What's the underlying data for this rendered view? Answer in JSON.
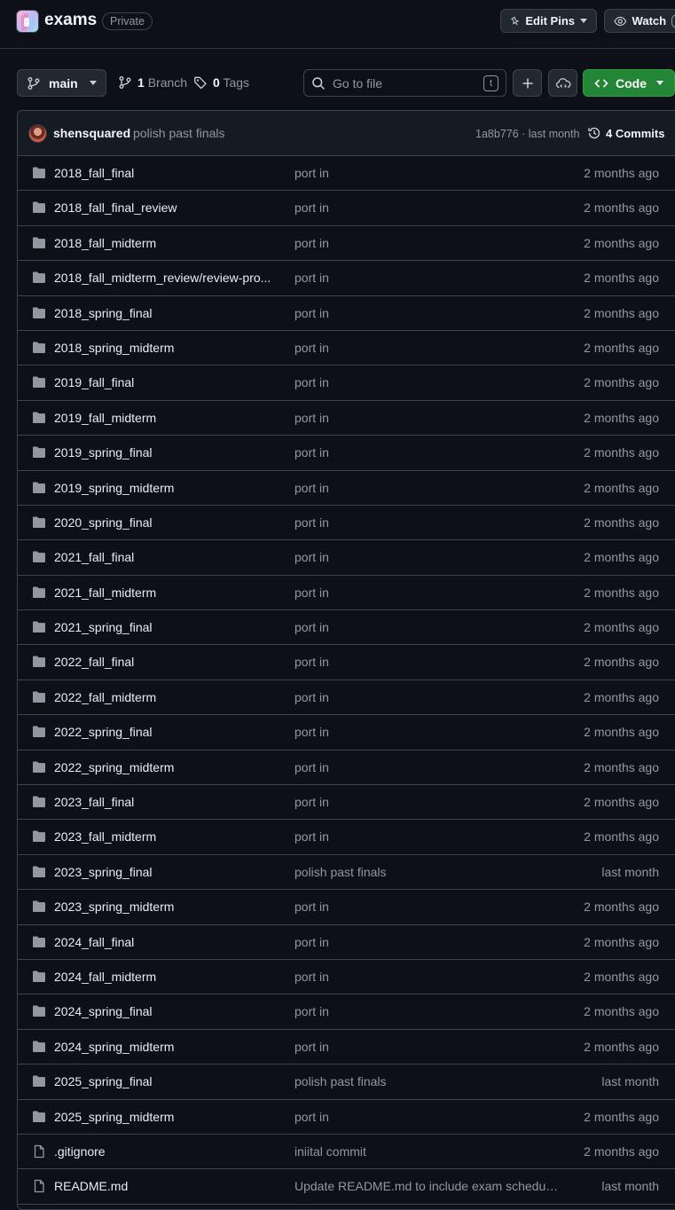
{
  "repo": {
    "name": "exams",
    "visibility": "Private"
  },
  "header_actions": {
    "edit_pins_label": "Edit Pins",
    "watch_label": "Watch"
  },
  "toolbar": {
    "branch_name": "main",
    "branch_count": "1",
    "branch_label": "Branch",
    "tag_count": "0",
    "tag_label": "Tags",
    "search_placeholder": "Go to file",
    "search_shortcut": "t",
    "code_label": "Code"
  },
  "latest_commit": {
    "author": "shensquared",
    "message": "polish past finals",
    "hash_and_time": "1a8b776 · last month",
    "commits_label": "4 Commits"
  },
  "files": [
    {
      "type": "folder",
      "name": "2018_fall_final",
      "message": "port in",
      "date": "2 months ago"
    },
    {
      "type": "folder",
      "name": "2018_fall_final_review",
      "message": "port in",
      "date": "2 months ago"
    },
    {
      "type": "folder",
      "name": "2018_fall_midterm",
      "message": "port in",
      "date": "2 months ago"
    },
    {
      "type": "folder",
      "name": "2018_fall_midterm_review/review-pro...",
      "message": "port in",
      "date": "2 months ago"
    },
    {
      "type": "folder",
      "name": "2018_spring_final",
      "message": "port in",
      "date": "2 months ago"
    },
    {
      "type": "folder",
      "name": "2018_spring_midterm",
      "message": "port in",
      "date": "2 months ago"
    },
    {
      "type": "folder",
      "name": "2019_fall_final",
      "message": "port in",
      "date": "2 months ago"
    },
    {
      "type": "folder",
      "name": "2019_fall_midterm",
      "message": "port in",
      "date": "2 months ago"
    },
    {
      "type": "folder",
      "name": "2019_spring_final",
      "message": "port in",
      "date": "2 months ago"
    },
    {
      "type": "folder",
      "name": "2019_spring_midterm",
      "message": "port in",
      "date": "2 months ago"
    },
    {
      "type": "folder",
      "name": "2020_spring_final",
      "message": "port in",
      "date": "2 months ago"
    },
    {
      "type": "folder",
      "name": "2021_fall_final",
      "message": "port in",
      "date": "2 months ago"
    },
    {
      "type": "folder",
      "name": "2021_fall_midterm",
      "message": "port in",
      "date": "2 months ago"
    },
    {
      "type": "folder",
      "name": "2021_spring_final",
      "message": "port in",
      "date": "2 months ago"
    },
    {
      "type": "folder",
      "name": "2022_fall_final",
      "message": "port in",
      "date": "2 months ago"
    },
    {
      "type": "folder",
      "name": "2022_fall_midterm",
      "message": "port in",
      "date": "2 months ago"
    },
    {
      "type": "folder",
      "name": "2022_spring_final",
      "message": "port in",
      "date": "2 months ago"
    },
    {
      "type": "folder",
      "name": "2022_spring_midterm",
      "message": "port in",
      "date": "2 months ago"
    },
    {
      "type": "folder",
      "name": "2023_fall_final",
      "message": "port in",
      "date": "2 months ago"
    },
    {
      "type": "folder",
      "name": "2023_fall_midterm",
      "message": "port in",
      "date": "2 months ago"
    },
    {
      "type": "folder",
      "name": "2023_spring_final",
      "message": "polish past finals",
      "date": "last month"
    },
    {
      "type": "folder",
      "name": "2023_spring_midterm",
      "message": "port in",
      "date": "2 months ago"
    },
    {
      "type": "folder",
      "name": "2024_fall_final",
      "message": "port in",
      "date": "2 months ago"
    },
    {
      "type": "folder",
      "name": "2024_fall_midterm",
      "message": "port in",
      "date": "2 months ago"
    },
    {
      "type": "folder",
      "name": "2024_spring_final",
      "message": "port in",
      "date": "2 months ago"
    },
    {
      "type": "folder",
      "name": "2024_spring_midterm",
      "message": "port in",
      "date": "2 months ago"
    },
    {
      "type": "folder",
      "name": "2025_spring_final",
      "message": "polish past finals",
      "date": "last month"
    },
    {
      "type": "folder",
      "name": "2025_spring_midterm",
      "message": "port in",
      "date": "2 months ago"
    },
    {
      "type": "file",
      "name": ".gitignore",
      "message": "iniital commit",
      "date": "2 months ago"
    },
    {
      "type": "file",
      "name": "README.md",
      "message": "Update README.md to include exam schedule ...",
      "date": "last month"
    }
  ],
  "icons": {
    "folder": "folder-icon",
    "file": "file-icon"
  },
  "colors": {
    "background": "#0d1117",
    "border": "#3d444d",
    "muted_text": "#9198a1",
    "folder_icon": "#9198a1",
    "code_button": "#238636"
  }
}
